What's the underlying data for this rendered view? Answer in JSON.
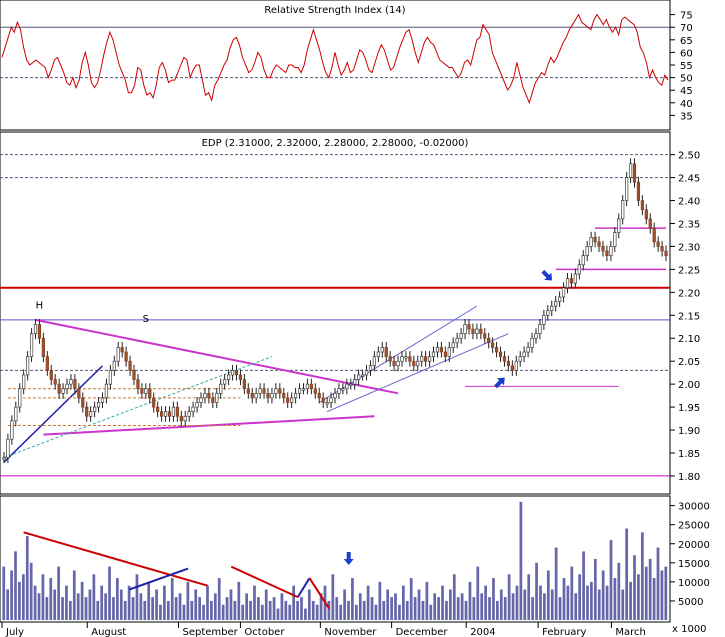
{
  "chart_data": [
    {
      "type": "line",
      "panel": "rsi",
      "title": "Relative Strength Index (14)",
      "ylim": [
        30,
        80
      ],
      "yticks": [
        35,
        40,
        45,
        50,
        55,
        60,
        65,
        70,
        75
      ],
      "reference_lines": [
        70,
        50
      ],
      "series": [
        {
          "color": "#cc0000",
          "values": [
            58,
            62,
            66,
            70,
            68,
            72,
            69,
            62,
            57,
            55,
            56,
            57,
            56,
            55,
            54,
            50,
            53,
            57,
            58,
            55,
            52,
            48,
            47,
            50,
            46,
            49,
            56,
            60,
            55,
            48,
            46,
            48,
            53,
            59,
            64,
            68,
            65,
            60,
            55,
            52,
            49,
            44,
            44,
            47,
            54,
            53,
            47,
            43,
            44,
            42,
            47,
            54,
            56,
            53,
            48,
            49,
            49,
            52,
            55,
            58,
            57,
            50,
            53,
            55,
            55,
            49,
            43,
            44,
            41,
            47,
            49,
            52,
            55,
            57,
            62,
            65,
            66,
            63,
            58,
            55,
            52,
            53,
            56,
            60,
            58,
            53,
            50,
            50,
            53,
            55,
            54,
            53,
            52,
            55,
            55,
            54,
            54,
            52,
            55,
            61,
            65,
            69,
            65,
            61,
            56,
            52,
            50,
            54,
            60,
            55,
            51,
            53,
            56,
            52,
            53,
            57,
            61,
            60,
            57,
            53,
            52,
            56,
            60,
            63,
            61,
            57,
            53,
            54,
            58,
            62,
            65,
            68,
            69,
            65,
            60,
            56,
            60,
            64,
            66,
            64,
            63,
            60,
            57,
            56,
            55,
            54,
            54,
            52,
            50,
            52,
            56,
            57,
            55,
            60,
            65,
            66,
            71,
            69,
            67,
            60,
            57,
            54,
            51,
            48,
            45,
            47,
            50,
            56,
            51,
            46,
            43,
            40,
            44,
            48,
            50,
            52,
            51,
            55,
            58,
            56,
            58,
            61,
            64,
            66,
            69,
            71,
            73,
            75,
            72,
            71,
            70,
            69,
            73,
            75,
            73,
            71,
            73,
            70,
            68,
            70,
            67,
            73,
            74,
            73,
            72,
            71,
            68,
            62,
            60,
            56,
            50,
            53,
            50,
            48,
            47,
            51,
            49
          ]
        }
      ]
    },
    {
      "type": "candlestick",
      "panel": "price",
      "title": "EDP (2.31000, 2.32000, 2.28000, 2.28000, -0.02000)",
      "ylim": [
        1.765,
        2.545
      ],
      "yticks": [
        1.8,
        1.85,
        1.9,
        1.95,
        2.0,
        2.05,
        2.1,
        2.15,
        2.2,
        2.25,
        2.3,
        2.35,
        2.4,
        2.45,
        2.5
      ],
      "series": [
        {
          "name": "EDP",
          "close": [
            1.84,
            1.88,
            1.92,
            1.95,
            1.99,
            2.02,
            2.06,
            2.11,
            2.13,
            2.1,
            2.06,
            2.03,
            2.01,
            2.0,
            1.98,
            1.99,
            2.0,
            2.01,
            1.99,
            1.97,
            1.95,
            1.93,
            1.94,
            1.95,
            1.96,
            1.97,
            2.0,
            2.03,
            2.05,
            2.08,
            2.07,
            2.05,
            2.03,
            2.01,
            1.99,
            1.98,
            1.99,
            1.97,
            1.95,
            1.94,
            1.93,
            1.94,
            1.93,
            1.95,
            1.93,
            1.92,
            1.93,
            1.94,
            1.95,
            1.96,
            1.97,
            1.98,
            1.97,
            1.96,
            1.98,
            2.0,
            2.01,
            2.02,
            2.03,
            2.02,
            2.01,
            1.99,
            1.98,
            1.97,
            1.98,
            1.99,
            1.98,
            1.97,
            1.98,
            1.99,
            1.98,
            1.97,
            1.96,
            1.97,
            1.98,
            1.99,
            1.99,
            2.0,
            1.99,
            1.98,
            1.97,
            1.96,
            1.96,
            1.97,
            1.98,
            1.99,
            1.99,
            2.0,
            2.0,
            2.01,
            2.02,
            2.02,
            2.03,
            2.04,
            2.06,
            2.07,
            2.08,
            2.06,
            2.05,
            2.04,
            2.05,
            2.06,
            2.06,
            2.05,
            2.04,
            2.05,
            2.06,
            2.05,
            2.06,
            2.07,
            2.08,
            2.07,
            2.06,
            2.08,
            2.09,
            2.1,
            2.11,
            2.13,
            2.12,
            2.11,
            2.12,
            2.11,
            2.1,
            2.09,
            2.08,
            2.07,
            2.06,
            2.05,
            2.04,
            2.03,
            2.05,
            2.06,
            2.07,
            2.08,
            2.1,
            2.11,
            2.13,
            2.15,
            2.16,
            2.17,
            2.18,
            2.19,
            2.21,
            2.23,
            2.22,
            2.24,
            2.26,
            2.28,
            2.3,
            2.32,
            2.31,
            2.3,
            2.29,
            2.28,
            2.3,
            2.33,
            2.36,
            2.4,
            2.45,
            2.48,
            2.44,
            2.4,
            2.38,
            2.36,
            2.34,
            2.31,
            2.3,
            2.29,
            2.28
          ]
        }
      ],
      "horizontal_lines": [
        {
          "y": 2.14,
          "color": "#5555cc"
        },
        {
          "y": 2.21,
          "color": "#cc0000"
        },
        {
          "y": 1.8,
          "color": "#cc00cc"
        },
        {
          "y": 2.5,
          "color": "#555577",
          "dash": true
        },
        {
          "y": 2.45,
          "color": "#555577",
          "dash": true
        },
        {
          "y": 2.03,
          "color": "#555577",
          "dash": true
        }
      ],
      "annotations": [
        "H",
        "S"
      ]
    },
    {
      "type": "bar",
      "panel": "volume",
      "ylim": [
        0,
        32000
      ],
      "yticks": [
        5000,
        10000,
        15000,
        20000,
        25000,
        30000
      ],
      "ytick_labels": [
        "5000",
        "10000",
        "15000",
        "20000",
        "25000",
        "30000"
      ],
      "unit_label": "x 1000",
      "series": [
        {
          "color": "#6666aa",
          "values": [
            14000,
            8000,
            13000,
            18000,
            10000,
            12000,
            22000,
            15000,
            9000,
            7000,
            12000,
            6000,
            11000,
            8000,
            14000,
            6000,
            9000,
            5000,
            13000,
            7000,
            10000,
            6000,
            8000,
            12000,
            5000,
            9000,
            7000,
            14000,
            6000,
            11000,
            8000,
            5000,
            9000,
            6000,
            12000,
            7000,
            5000,
            10000,
            6000,
            8000,
            4000,
            9000,
            5000,
            11000,
            6000,
            7000,
            4000,
            10000,
            5000,
            8000,
            6000,
            4000,
            9000,
            5000,
            7000,
            11000,
            4000,
            6000,
            8000,
            5000,
            10000,
            4000,
            7000,
            5000,
            9000,
            6000,
            4000,
            8000,
            5000,
            6000,
            3000,
            7000,
            5000,
            4000,
            9000,
            5000,
            6000,
            3000,
            8000,
            5000,
            4000,
            7000,
            9000,
            5000,
            12000,
            6000,
            4000,
            8000,
            5000,
            11000,
            4000,
            7000,
            5000,
            9000,
            6000,
            4000,
            10000,
            5000,
            8000,
            6000,
            7000,
            4000,
            9000,
            5000,
            11000,
            6000,
            8000,
            5000,
            10000,
            4000,
            7000,
            6000,
            9000,
            5000,
            8000,
            12000,
            6000,
            7000,
            5000,
            10000,
            6000,
            14000,
            7000,
            9000,
            6000,
            11000,
            5000,
            8000,
            6000,
            12000,
            7000,
            9000,
            31000,
            8000,
            12000,
            6000,
            15000,
            9000,
            7000,
            13000,
            8000,
            19000,
            6000,
            11000,
            9000,
            14000,
            7000,
            12000,
            18000,
            9000,
            10000,
            16000,
            8000,
            13000,
            9000,
            21000,
            11000,
            15000,
            8000,
            24000,
            10000,
            17000,
            12000,
            23000,
            14000,
            16000,
            11000,
            19000,
            13000,
            14000
          ]
        }
      ],
      "annotations": [
        "downward-arrow"
      ]
    }
  ],
  "x_axis": {
    "labels": [
      "July",
      "August",
      "September",
      "October",
      "November",
      "December",
      "2004",
      "February",
      "March"
    ]
  }
}
